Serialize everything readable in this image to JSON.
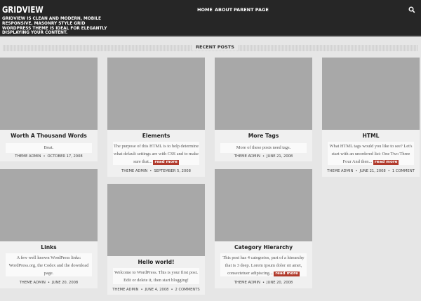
{
  "site": {
    "title": "GRIDVIEW",
    "description": "GRIDVIEW IS CLEAN AND MODERN, MOBILE RESPONSIVE, MASONRY STYLE GRID WORDPRESS THEME IS IDEAL FOR ELEGANTLY DISPLAYING YOUR CONTENT."
  },
  "nav": {
    "items": [
      {
        "label": "HOME"
      },
      {
        "label": "ABOUT"
      },
      {
        "label": "PARENT PAGE"
      }
    ]
  },
  "section": {
    "title": "RECENT POSTS"
  },
  "posts": [
    {
      "title": "Worth A Thousand Words",
      "excerpt": "Boat.",
      "author": "THEME ADMIN",
      "date": "OCTOBER 17, 2008"
    },
    {
      "title": "Elements",
      "excerpt": "The purpose of this HTML is to help determine what default settings are with CSS and to make sure that...",
      "read_more": "read more",
      "author": "THEME ADMIN",
      "date": "SEPTEMBER 5, 2008"
    },
    {
      "title": "More Tags",
      "excerpt": "More of these posts need tags.",
      "author": "THEME ADMIN",
      "date": "JUNE 21, 2008"
    },
    {
      "title": "HTML",
      "excerpt": "What HTML tags would you like to see? Let's start with an unordered list: One Two Three Four And then...",
      "read_more": "read more",
      "author": "THEME ADMIN",
      "date": "JUNE 21, 2008",
      "comments": "1 COMMENT"
    },
    {
      "title": "Links",
      "excerpt": "A few well known WordPress links: WordPress.org, the Codex and the download page.",
      "author": "THEME ADMIN",
      "date": "JUNE 20, 2008"
    },
    {
      "title": "Hello world!",
      "excerpt": "Welcome to WordPress. This is your first post. Edit or delete it, then start blogging!",
      "author": "THEME ADMIN",
      "date": "JUNE 4, 2008",
      "comments": "2 COMMENTS"
    },
    {
      "title": "Category Hierarchy",
      "excerpt": "This post has 4 categories, part of a hierarchy that is 3 deep. Lorem ipsum dolor sit amet, consectetuer adipiscing...",
      "read_more": "read more",
      "author": "THEME ADMIN",
      "date": "JUNE 20, 2008"
    }
  ],
  "colors": {
    "header_bg": "#262626",
    "page_bg": "#e6e6e6",
    "accent": "#b13a2c",
    "thumbnail": "#a8a8a8"
  }
}
